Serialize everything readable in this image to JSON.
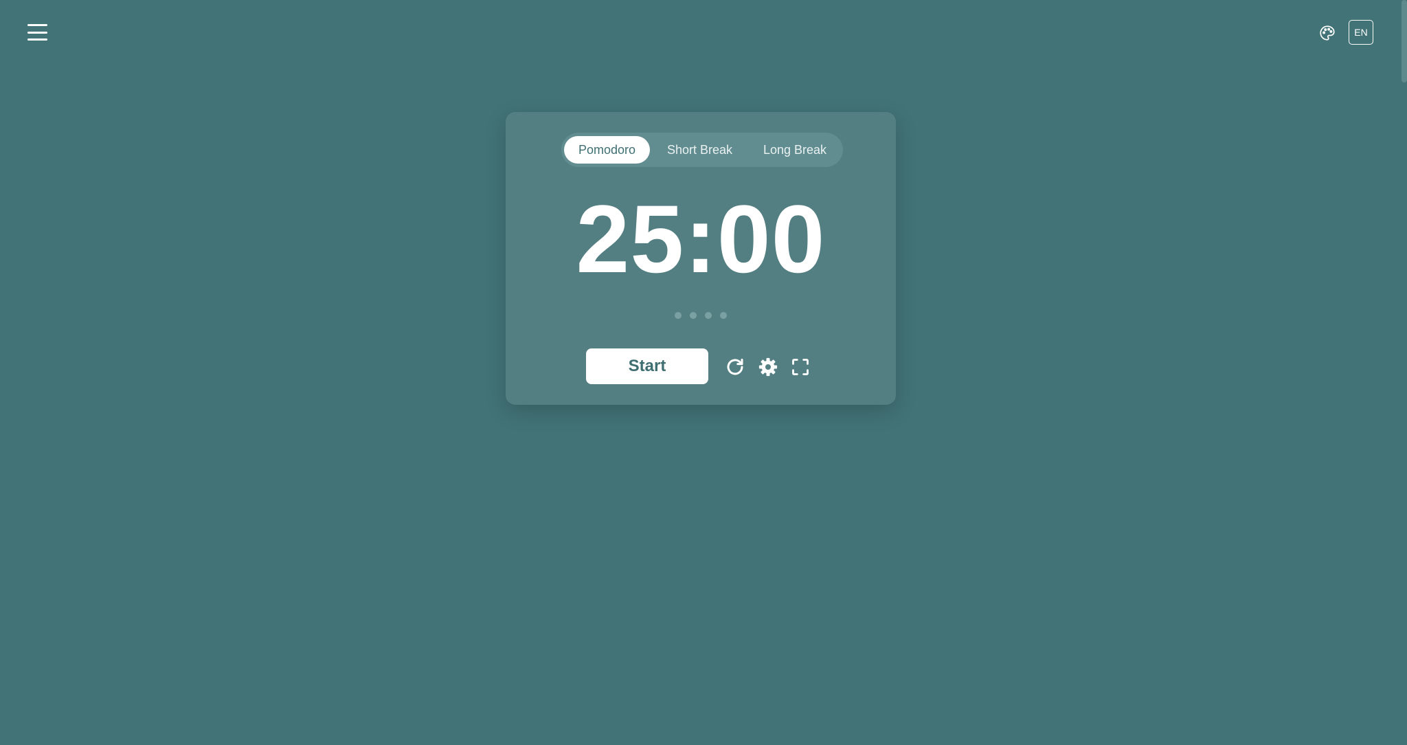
{
  "header": {
    "menu_icon": "hamburger-menu-icon",
    "theme_icon": "palette-icon",
    "language_label": "EN"
  },
  "timer_card": {
    "tabs": [
      {
        "label": "Pomodoro",
        "active": true
      },
      {
        "label": "Short Break",
        "active": false
      },
      {
        "label": "Long Break",
        "active": false
      }
    ],
    "time_display": "25:00",
    "session_dots_count": 4,
    "start_label": "Start",
    "controls": [
      {
        "icon": "reset-icon"
      },
      {
        "icon": "gear-icon"
      },
      {
        "icon": "fullscreen-icon"
      }
    ]
  },
  "colors": {
    "background": "#427377",
    "card": "#537f82",
    "tab_track": "#628d90",
    "accent_text": "#3f6e71",
    "dot": "#7ba0a3",
    "foreground": "#ffffff"
  }
}
